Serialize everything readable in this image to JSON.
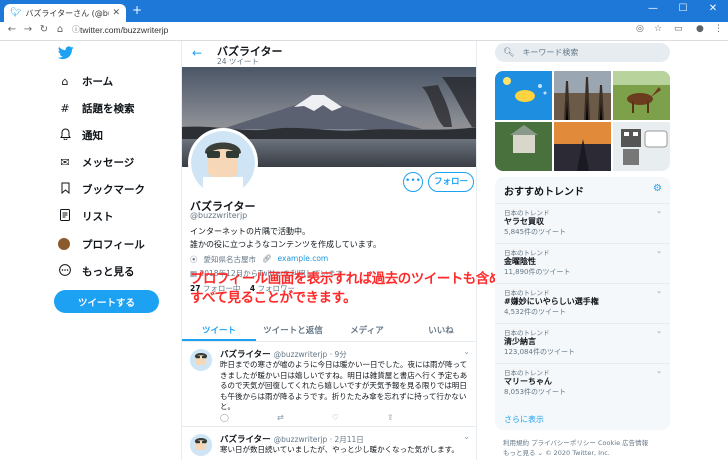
{
  "browser": {
    "tab_title": "バズライターさん (@buzzwriterjp) / Twitter",
    "url": "twitter.com/buzzwriterjp",
    "new_tab": "+",
    "back": "←",
    "forward": "→",
    "reload": "↻",
    "home": "⌂",
    "star": "☆",
    "minimize": "—",
    "maximize": "☐",
    "close": "✕"
  },
  "nav": {
    "items": [
      {
        "label": "ホーム",
        "icon": "home-icon",
        "glyph": "⌂"
      },
      {
        "label": "話題を検索",
        "icon": "hashtag-icon",
        "glyph": "#"
      },
      {
        "label": "通知",
        "icon": "bell-icon",
        "glyph": "🔔︎"
      },
      {
        "label": "メッセージ",
        "icon": "mail-icon",
        "glyph": "✉"
      },
      {
        "label": "ブックマーク",
        "icon": "bookmark-icon",
        "glyph": "⛉"
      },
      {
        "label": "リスト",
        "icon": "list-icon",
        "glyph": "☰"
      },
      {
        "label": "プロフィール",
        "icon": "profile-avatar",
        "glyph": ""
      },
      {
        "label": "もっと見る",
        "icon": "more-icon",
        "glyph": "⋯"
      }
    ],
    "tweet_button": "ツイートする"
  },
  "profile": {
    "header_name": "バズライター",
    "tweet_count": "24 ツイート",
    "display_name": "バズライター",
    "handle": "@buzzwriterjp",
    "bio_lines": [
      "インターネットの片隅で活動中。",
      "誰かの役に立つようなコンテンツを作成しています。"
    ],
    "location": "愛知県名古屋市",
    "website": "example.com",
    "joined": "2018年12月からTwitterを利用しています",
    "following_count": "27",
    "following_label": "フォロー中",
    "followers_count": "4",
    "followers_label": "フォロワー",
    "more_button": "•••",
    "follow_button": "フォロー"
  },
  "overlay_text": [
    "プロフィール画面を表示すれば過去のツイートも含めて",
    "すべて見ることができます。"
  ],
  "tabs": [
    {
      "label": "ツイート",
      "active": true
    },
    {
      "label": "ツイートと返信",
      "active": false
    },
    {
      "label": "メディア",
      "active": false
    },
    {
      "label": "いいね",
      "active": false
    }
  ],
  "tweets": [
    {
      "name": "バズライター",
      "meta": "@buzzwriterjp · 9分",
      "text": "昨日までの寒さが嘘のように今日は暖かい一日でした。夜には雨が降ってきましたが暖かい日は嬉しいですね。明日は雑貨屋と書店へ行く予定もあるので天気が回復してくれたら嬉しいですが天気予報を見る限りでは明日も午後からは雨が降るようです。折りたたみ傘を忘れずに持って行かないと。"
    },
    {
      "name": "バズライター",
      "meta": "@buzzwriterjp · 2月11日",
      "text": "寒い日が数日続いていましたが、やっと少し暖かくなった気がします。"
    }
  ],
  "search": {
    "placeholder": "キーワード検索"
  },
  "trends": {
    "title": "おすすめトレンド",
    "items": [
      {
        "category": "日本のトレンド",
        "name": "ヤラセ買収",
        "count": "5,845件のツイート"
      },
      {
        "category": "日本のトレンド",
        "name": "金曜陰性",
        "count": "11,890件のツイート"
      },
      {
        "category": "日本のトレンド",
        "name": "#嫌妙にいやらしい選手権",
        "count": "4,532件のツイート"
      },
      {
        "category": "日本のトレンド",
        "name": "清少納言",
        "count": "123,084件のツイート"
      },
      {
        "category": "日本のトレンド",
        "name": "マリーちゃん",
        "count": "8,053件のツイート"
      }
    ],
    "show_more": "さらに表示"
  },
  "footer": {
    "line1": "利用規約  プライバシーポリシー  Cookie  広告情報",
    "line2": "もっと見る ⌄  © 2020 Twitter, Inc."
  },
  "colors": {
    "accent": "#1da1f2",
    "overlay": "#ff2a2a",
    "chrome": "#1e78d7"
  }
}
